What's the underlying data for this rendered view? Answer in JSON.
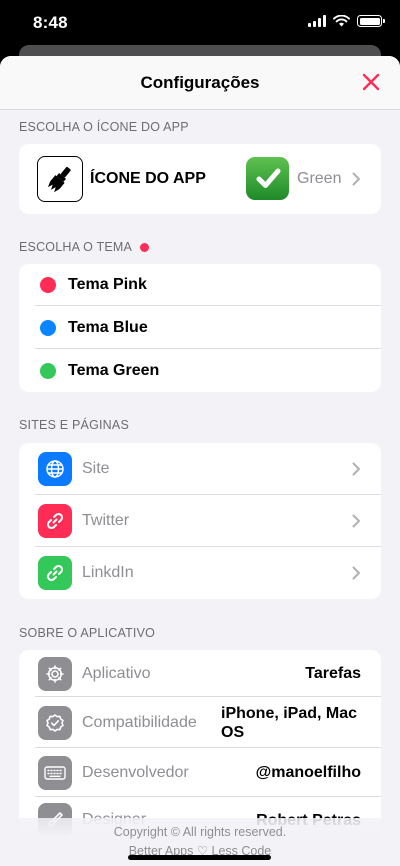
{
  "status": {
    "time": "8:48"
  },
  "nav": {
    "title": "Configurações",
    "close_icon": "close-x-icon"
  },
  "app_icon_section": {
    "header": "ESCOLHA O ÍCONE DO APP",
    "label": "ÍCONE DO APP",
    "value": "Green",
    "icon": "paintbrush-icon",
    "selected_icon": "checkmark-icon"
  },
  "theme_section": {
    "header": "ESCOLHA O TEMA",
    "items": [
      {
        "label": "Tema Pink",
        "color": "#ff2d55"
      },
      {
        "label": "Tema Blue",
        "color": "#0a84ff"
      },
      {
        "label": "Tema Green",
        "color": "#34c759"
      }
    ]
  },
  "sites_section": {
    "header": "SITES E PÁGINAS",
    "items": [
      {
        "label": "Site",
        "icon": "globe-icon",
        "color": "#0a7aff"
      },
      {
        "label": "Twitter",
        "icon": "link-icon",
        "color": "#ff2d55"
      },
      {
        "label": "LinkdIn",
        "icon": "link-icon",
        "color": "#34c759"
      }
    ]
  },
  "about_section": {
    "header": "SOBRE O APLICATIVO",
    "items": [
      {
        "label": "Aplicativo",
        "value": "Tarefas",
        "icon": "gear-icon"
      },
      {
        "label": "Compatibilidade",
        "value": "iPhone, iPad, Mac OS",
        "icon": "checkmark-seal-icon"
      },
      {
        "label": "Desenvolvedor",
        "value": "@manoelfilho",
        "icon": "keyboard-icon"
      },
      {
        "label": "Designer",
        "value": "Robert Petras",
        "icon": "paintbrush-icon"
      }
    ]
  },
  "footer": {
    "line1": "Copyright © All rights reserved.",
    "line2": "Better Apps ♡ Less Code"
  },
  "colors": {
    "accent": "#ff2d55",
    "tile_gray": "#8e8e93"
  }
}
